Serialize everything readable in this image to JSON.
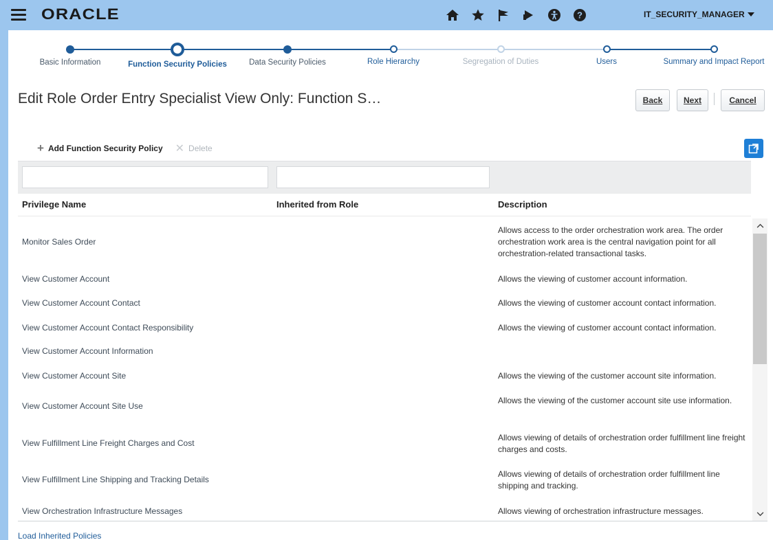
{
  "header": {
    "logo": "ORACLE",
    "user": "IT_SECURITY_MANAGER",
    "icons": [
      "home-icon",
      "favorites-star-icon",
      "notifications-flag-icon",
      "watchlist-icon",
      "accessibility-icon",
      "help-icon"
    ],
    "background": "#9cc6ee"
  },
  "train": {
    "stops": [
      {
        "label": "Basic Information",
        "state": "visited"
      },
      {
        "label": "Function Security Policies",
        "state": "current"
      },
      {
        "label": "Data Security Policies",
        "state": "visited"
      },
      {
        "label": "Role Hierarchy",
        "state": "future"
      },
      {
        "label": "Segregation of Duties",
        "state": "disabled"
      },
      {
        "label": "Users",
        "state": "future"
      },
      {
        "label": "Summary and Impact Report",
        "state": "future"
      }
    ],
    "accent": "#1f5c99"
  },
  "page": {
    "title": "Edit Role Order Entry Specialist View Only: Function S…",
    "buttons": {
      "back": "Back",
      "next": "Next",
      "cancel": "Cancel"
    }
  },
  "toolbar": {
    "add_label": "Add Function Security Policy",
    "delete_label": "Delete"
  },
  "table": {
    "columns": [
      "Privilege Name",
      "Inherited from Role",
      "Description"
    ],
    "rows": [
      {
        "name": "Monitor Sales Order",
        "inherited": "",
        "description": "Allows access to the order orchestration work area. The order orchestration work area is the central navigation point for all orchestration-related transactional tasks."
      },
      {
        "name": "View Customer Account",
        "inherited": "",
        "description": "Allows the viewing of customer account information."
      },
      {
        "name": "View Customer Account Contact",
        "inherited": "",
        "description": "Allows the viewing of customer account contact information."
      },
      {
        "name": "View Customer Account Contact Responsibility",
        "inherited": "",
        "description": "Allows the viewing of customer account contact information."
      },
      {
        "name": "View Customer Account Information",
        "inherited": "",
        "description": ""
      },
      {
        "name": "View Customer Account Site",
        "inherited": "",
        "description": "Allows the viewing of the customer account site information."
      },
      {
        "name": "View Customer Account Site Use",
        "inherited": "",
        "description": "Allows the viewing of the customer account site use information."
      },
      {
        "name": "View Fulfillment Line Freight Charges and Cost",
        "inherited": "",
        "description": "Allows viewing of details of orchestration order fulfillment line freight charges and costs."
      },
      {
        "name": "View Fulfillment Line Shipping and Tracking Details",
        "inherited": "",
        "description": "Allows viewing of details of orchestration order fulfillment line shipping and tracking."
      },
      {
        "name": "View Orchestration Infrastructure Messages",
        "inherited": "",
        "description": "Allows viewing of orchestration infrastructure messages."
      }
    ]
  },
  "footer": {
    "link": "Load Inherited Policies"
  }
}
